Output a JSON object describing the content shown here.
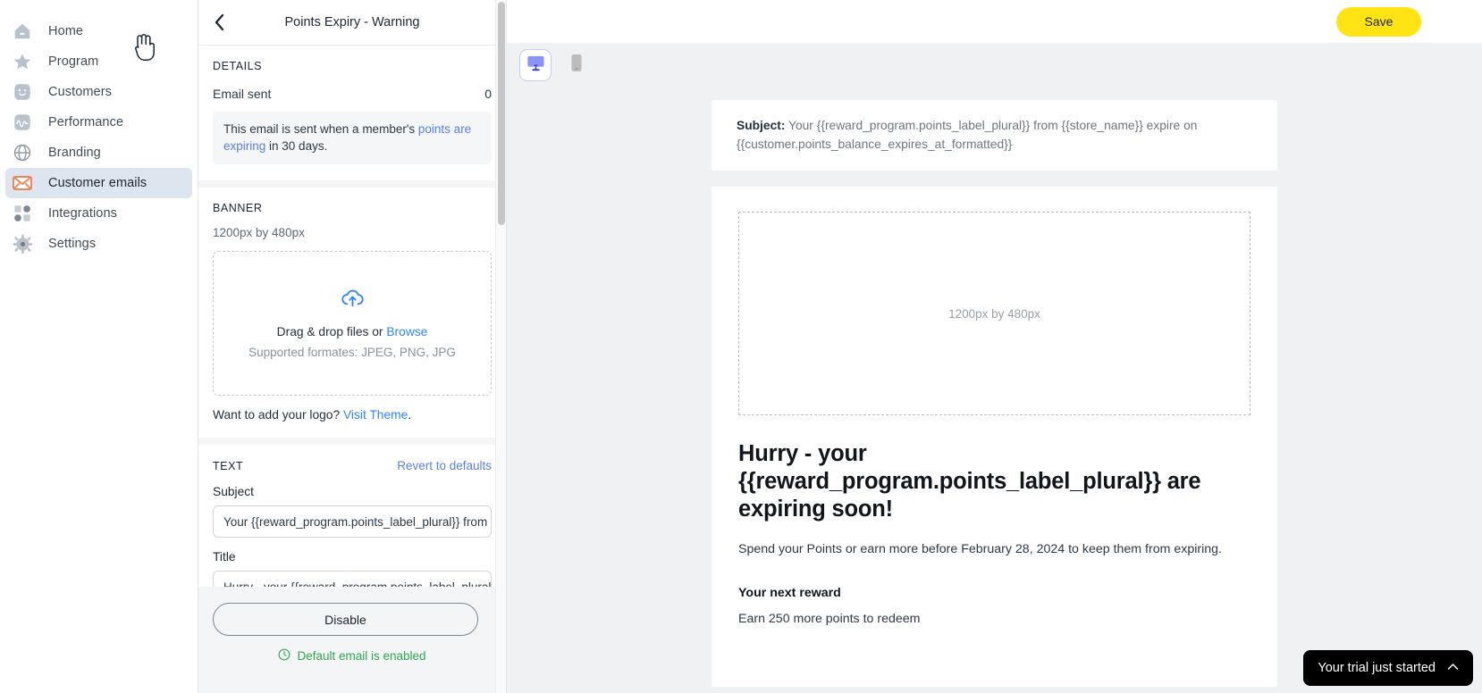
{
  "sidebar": {
    "items": [
      {
        "label": "Home",
        "icon": "home-icon",
        "active": false
      },
      {
        "label": "Program",
        "icon": "star-icon",
        "active": false
      },
      {
        "label": "Customers",
        "icon": "smiley-face-icon",
        "active": false
      },
      {
        "label": "Performance",
        "icon": "pulse-chart-icon",
        "active": false
      },
      {
        "label": "Branding",
        "icon": "globe-icon",
        "active": false
      },
      {
        "label": "Customer emails",
        "icon": "envelope-icon",
        "active": true
      },
      {
        "label": "Integrations",
        "icon": "grid-squares-icon",
        "active": false
      },
      {
        "label": "Settings",
        "icon": "gear-icon",
        "active": false
      }
    ]
  },
  "panel": {
    "back_icon": "chevron-left-icon",
    "title": "Points Expiry - Warning",
    "details": {
      "section_label": "DETAILS",
      "email_sent_label": "Email sent",
      "email_sent_value": "0",
      "info_prefix": "This email is sent when a member's ",
      "info_link": "points are expiring",
      "info_suffix": " in 30 days."
    },
    "banner": {
      "section_label": "BANNER",
      "dimensions": "1200px by 480px",
      "upload_icon": "cloud-upload-icon",
      "drop_text": "Drag & drop files or ",
      "browse_link": "Browse",
      "formats": "Supported formates: JPEG, PNG, JPG",
      "logo_prefix": "Want to add your logo? ",
      "logo_link": "Visit Theme",
      "logo_suffix": "."
    },
    "text": {
      "section_label": "TEXT",
      "revert_label": "Revert to defaults",
      "subject_label": "Subject",
      "subject_value": "Your {{reward_program.points_label_plural}} from {{store_name}} expire on {{customer.points_balance_expires_at_formatted}}",
      "title_label": "Title",
      "title_value": "Hurry - your {{reward_program.points_label_plural}} are expiring soon!"
    },
    "footer": {
      "disable_button": "Disable",
      "status_icon": "clock-check-icon",
      "status_text": "Default email is enabled",
      "status_color": "#2ea84f"
    }
  },
  "main": {
    "save_label": "Save",
    "save_color": "#ffe312",
    "devices": [
      {
        "name": "desktop",
        "icon": "monitor-icon",
        "active": true
      },
      {
        "name": "mobile",
        "icon": "phone-icon",
        "active": false
      }
    ],
    "preview": {
      "subject_label": "Subject:",
      "subject_body": " Your {{reward_program.points_label_plural}} from {{store_name}} expire on {{customer.points_balance_expires_at_formatted}}",
      "banner_placeholder": "1200px by 480px",
      "heading": "Hurry - your {{reward_program.points_label_plural}} are expiring soon!",
      "paragraph": "Spend your Points or earn more before February 28, 2024 to keep them from expiring.",
      "reward_heading": "Your next reward",
      "reward_text": "Earn 250 more points to redeem"
    },
    "trial": {
      "label": "Your trial just started",
      "chevron_icon": "chevron-up-icon",
      "chevron": "⌃"
    }
  }
}
